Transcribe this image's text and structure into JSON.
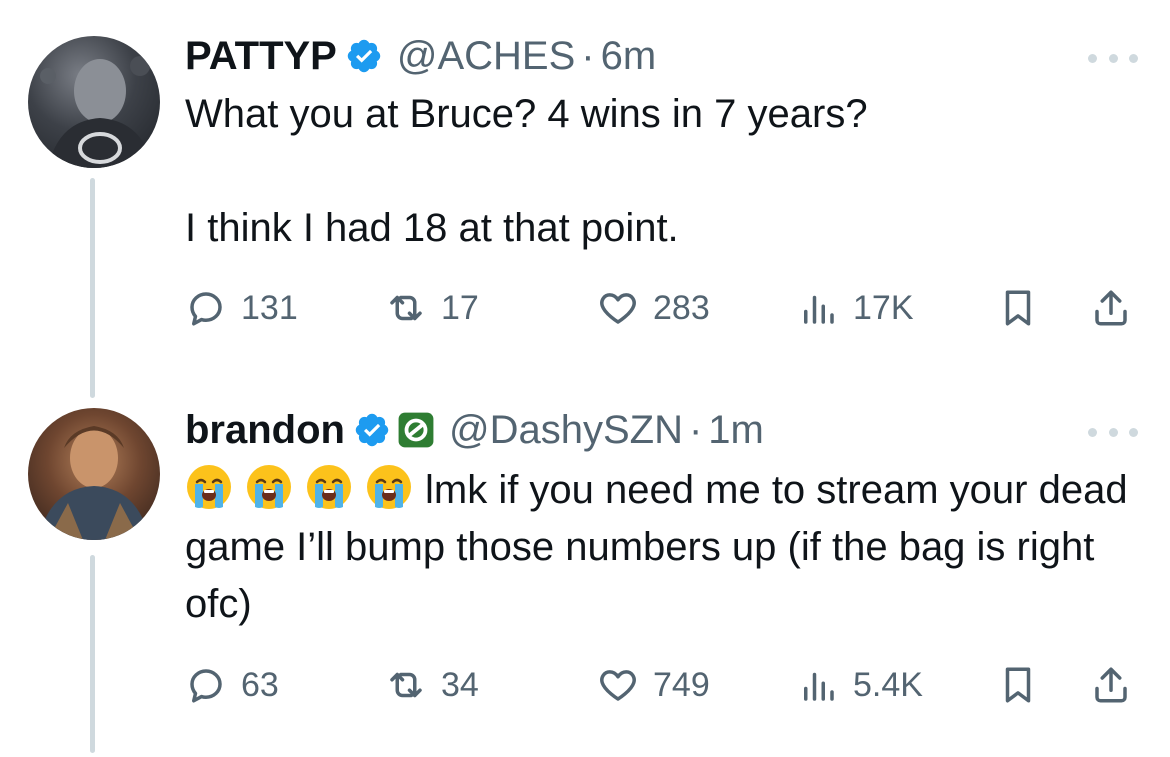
{
  "tweets": [
    {
      "name": "PATTYP",
      "handle": "@ACHES",
      "separator": "·",
      "time": "6m",
      "text": "What you at Bruce? 4 wins in 7 years?\n\nI think I had 18 at that point.",
      "emojis": [],
      "replies": "131",
      "reposts": "17",
      "likes": "283",
      "views": "17K"
    },
    {
      "name": "brandon",
      "handle": "@DashySZN",
      "separator": "·",
      "time": "1m",
      "emojis": [
        "loudly-crying-face",
        "loudly-crying-face",
        "loudly-crying-face",
        "loudly-crying-face"
      ],
      "text": "lmk if you need me to stream your dead game I’ll bump those numbers up (if the bag is right ofc)",
      "replies": "63",
      "reposts": "34",
      "likes": "749",
      "views": "5.4K"
    }
  ],
  "icons": {
    "verified": "verified-badge-icon",
    "affiliate": "optic-affiliate-icon",
    "reply": "reply-icon",
    "repost": "repost-icon",
    "like": "heart-icon",
    "views": "views-icon",
    "bookmark": "bookmark-icon",
    "share": "share-icon",
    "more": "more-icon"
  },
  "colors": {
    "verified_blue": "#1d9bf0",
    "secondary_text": "#536471",
    "thread_line": "#cfd9de",
    "affiliate_green": "#2e7d32"
  }
}
